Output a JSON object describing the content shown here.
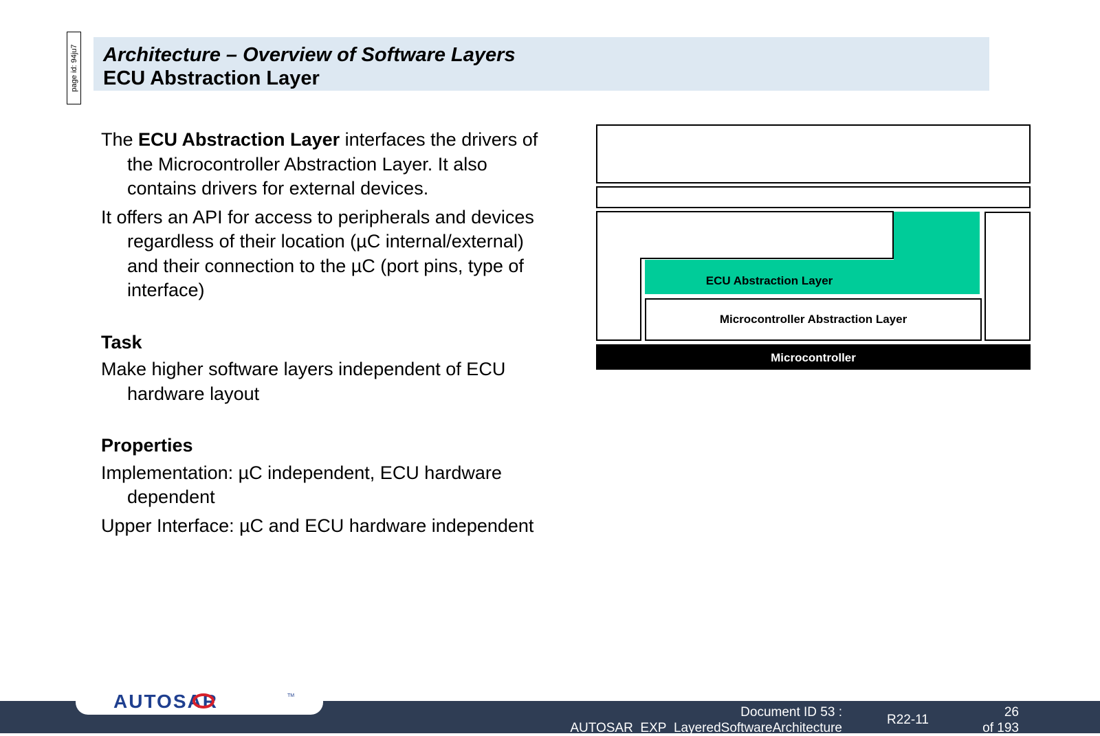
{
  "page_id_label": "page id: 94ju7",
  "title": {
    "line1": "Architecture – Overview of Software Layers",
    "line2": "ECU Abstraction Layer"
  },
  "body": {
    "intro_prefix": "The ",
    "intro_bold": "ECU Abstraction Layer",
    "intro_rest": " interfaces the drivers of the Microcontroller Abstraction Layer. It also contains drivers for external devices.",
    "api_paragraph": "It offers an API for access to peripherals and devices regardless of their location (µC internal/external) and their connection to the µC (port pins, type of interface)",
    "task_heading": "Task",
    "task_text": "Make higher software layers independent of ECU hardware layout",
    "properties_heading": "Properties",
    "implementation_text": "Implementation: µC independent, ECU hardware dependent",
    "upper_interface_text": "Upper Interface: µC and ECU hardware independent"
  },
  "diagram": {
    "ecu_abstraction_label": "ECU Abstraction Layer",
    "mcal_label": "Microcontroller Abstraction Layer",
    "microcontroller_label": "Microcontroller",
    "highlight_color": "#00cc99"
  },
  "footer": {
    "logo_text": "AUTOSAR",
    "trademark": "TM",
    "doc_id_line1": "Document ID 53 :",
    "doc_id_line2": "AUTOSAR_EXP_LayeredSoftwareArchitecture",
    "release": "R22-11",
    "page_number": "26",
    "page_total": "of 193"
  },
  "colors": {
    "title_bar": "#dde8f2",
    "footer_bar": "#2f3d54",
    "logo_blue": "#1f3f8f",
    "logo_red": "#d8202a"
  }
}
